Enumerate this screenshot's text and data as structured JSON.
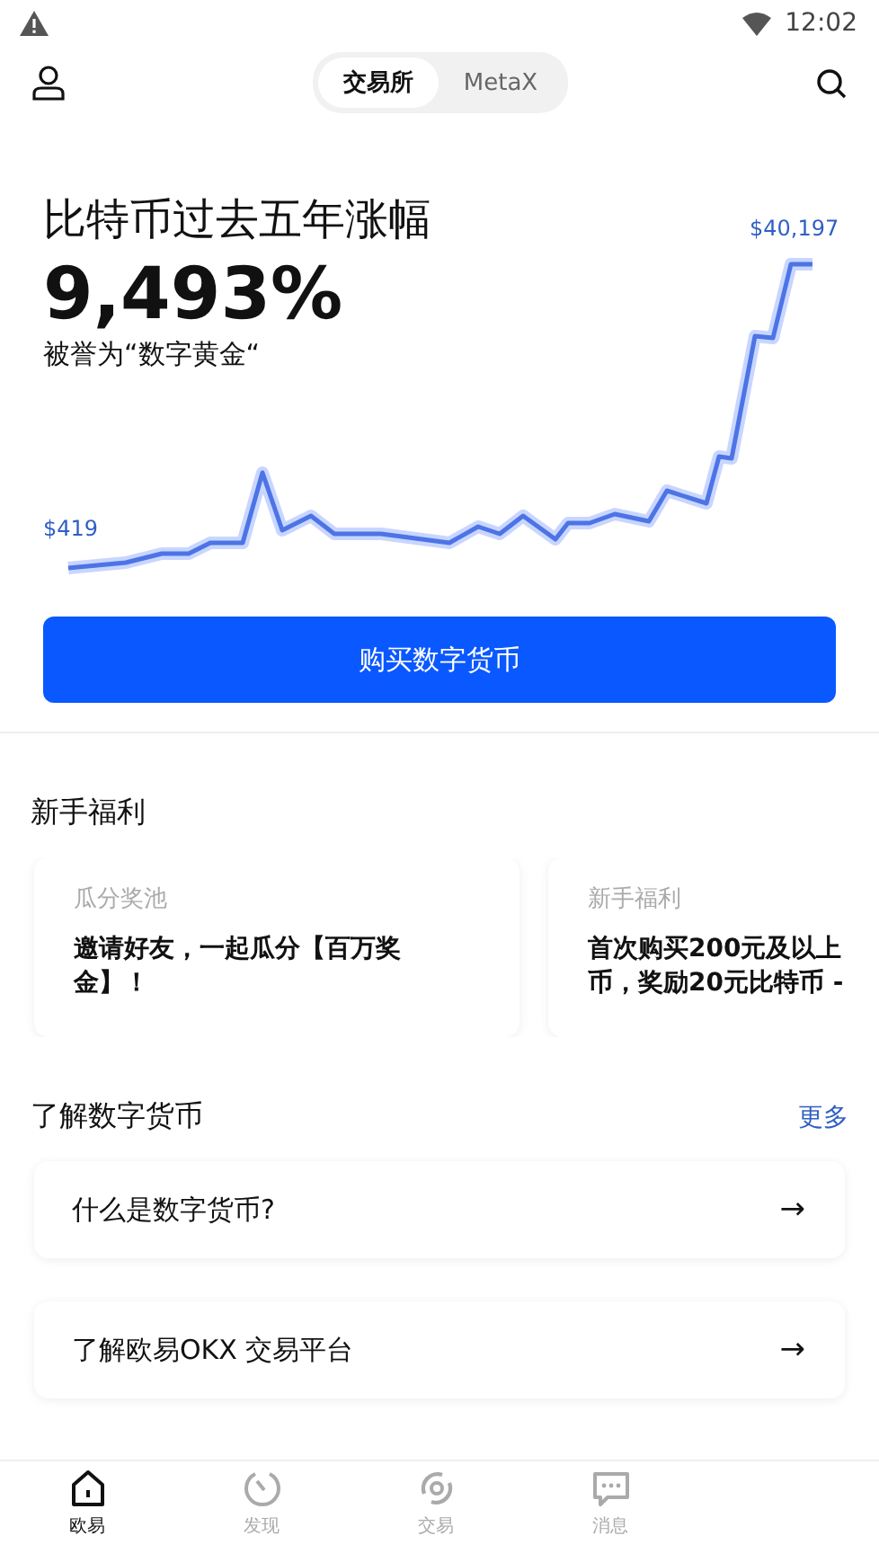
{
  "status_bar": {
    "time": "12:02"
  },
  "header": {
    "segments": [
      {
        "label": "交易所",
        "selected": true
      },
      {
        "label": "MetaX",
        "selected": false
      }
    ]
  },
  "hero": {
    "title": "比特币过去五年涨幅",
    "value": "9,493%",
    "subtitle": "被誉为“数字黄金“",
    "low_label": "$419",
    "high_label": "$40,197",
    "button": "购买数字货币"
  },
  "benefits": {
    "title": "新手福利",
    "cards": [
      {
        "tag": "瓜分奖池",
        "text": "邀请好友，一起瓜分【百万奖金】！"
      },
      {
        "tag": "新手福利",
        "text": "首次购买200元及以上币，奖励20元比特币 -"
      }
    ]
  },
  "learn": {
    "title": "了解数字货币",
    "more": "更多",
    "items": [
      {
        "label": "什么是数字货币?",
        "arrow": "→"
      },
      {
        "label": "了解欧易OKX 交易平台",
        "arrow": "→"
      }
    ]
  },
  "nav": [
    {
      "label": "欧易",
      "kind": "home",
      "selected": true
    },
    {
      "label": "发现",
      "kind": "discover",
      "selected": false
    },
    {
      "label": "交易",
      "kind": "trade",
      "selected": false
    },
    {
      "label": "消息",
      "kind": "message",
      "selected": false
    }
  ]
}
